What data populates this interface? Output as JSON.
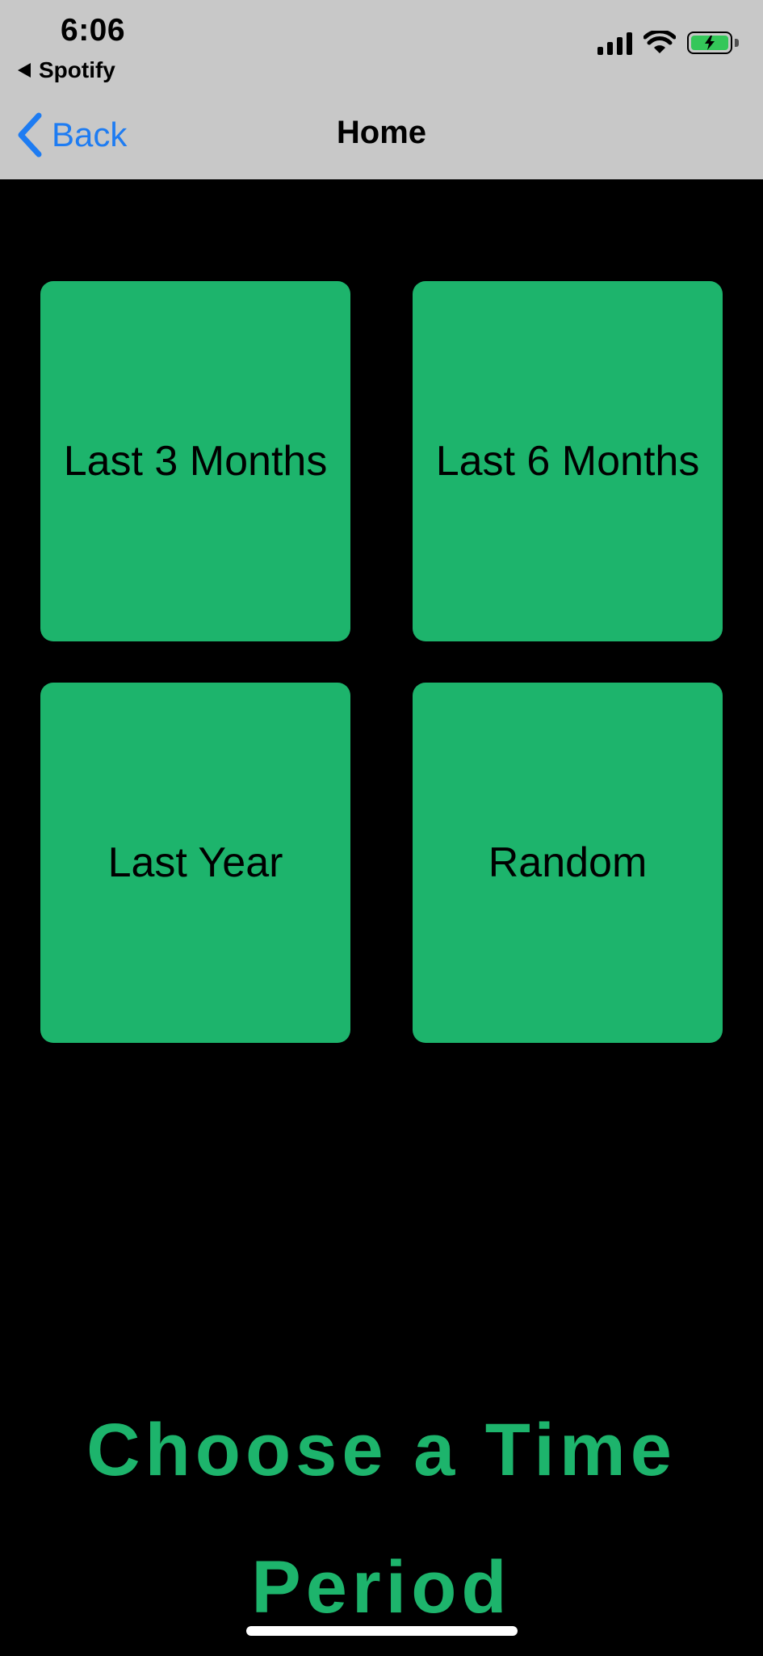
{
  "status_bar": {
    "time": "6:06",
    "back_app_label": "Spotify",
    "battery_color": "#34c759",
    "icons": [
      "cellular-signal-icon",
      "wifi-icon",
      "battery-charging-icon"
    ]
  },
  "nav_bar": {
    "back_label": "Back",
    "title": "Home",
    "accent_color": "#1e7cf2"
  },
  "tiles": [
    {
      "label": "Last 3 Months"
    },
    {
      "label": "Last 6 Months"
    },
    {
      "label": "Last Year"
    },
    {
      "label": "Random"
    }
  ],
  "heading": "Choose a Time Period",
  "colors": {
    "background": "#000000",
    "tile": "#1db46c",
    "header": "#c8c8c8"
  }
}
